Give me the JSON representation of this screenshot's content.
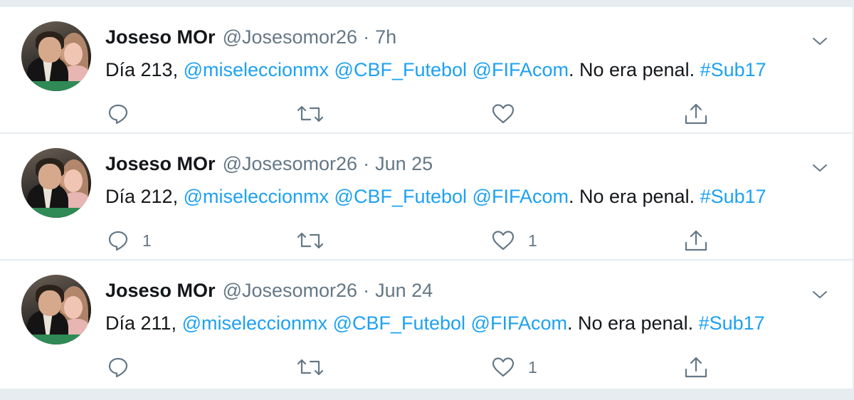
{
  "colors": {
    "link": "#1da1f2",
    "muted": "#657786",
    "text": "#14171a",
    "divider": "#e6ecf0"
  },
  "icons": {
    "reply": "reply-icon",
    "retweet": "retweet-icon",
    "like": "heart-icon",
    "share": "share-icon",
    "caret": "chevron-down-icon"
  },
  "tweets": [
    {
      "name": "Joseso MOr",
      "handle": "@Josesomor26",
      "separator": "·",
      "time": "7h",
      "text_prefix": "Día 213, ",
      "mention1": "@miseleccionmx",
      "space1": " ",
      "mention2": "@CBF_Futebol",
      "space2": " ",
      "mention3": "@FIFAcom",
      "text_suffix": ". No era penal. ",
      "hashtag": "#Sub17",
      "reply_count": "",
      "like_count": ""
    },
    {
      "name": "Joseso MOr",
      "handle": "@Josesomor26",
      "separator": "·",
      "time": "Jun 25",
      "text_prefix": "Día 212, ",
      "mention1": "@miseleccionmx",
      "space1": " ",
      "mention2": "@CBF_Futebol",
      "space2": " ",
      "mention3": "@FIFAcom",
      "text_suffix": ". No era penal. ",
      "hashtag": "#Sub17",
      "reply_count": "1",
      "like_count": "1"
    },
    {
      "name": "Joseso MOr",
      "handle": "@Josesomor26",
      "separator": "·",
      "time": "Jun 24",
      "text_prefix": "Día 211, ",
      "mention1": "@miseleccionmx",
      "space1": " ",
      "mention2": "@CBF_Futebol",
      "space2": " ",
      "mention3": "@FIFAcom",
      "text_suffix": ". No era penal. ",
      "hashtag": "#Sub17",
      "reply_count": "",
      "like_count": "1"
    }
  ]
}
